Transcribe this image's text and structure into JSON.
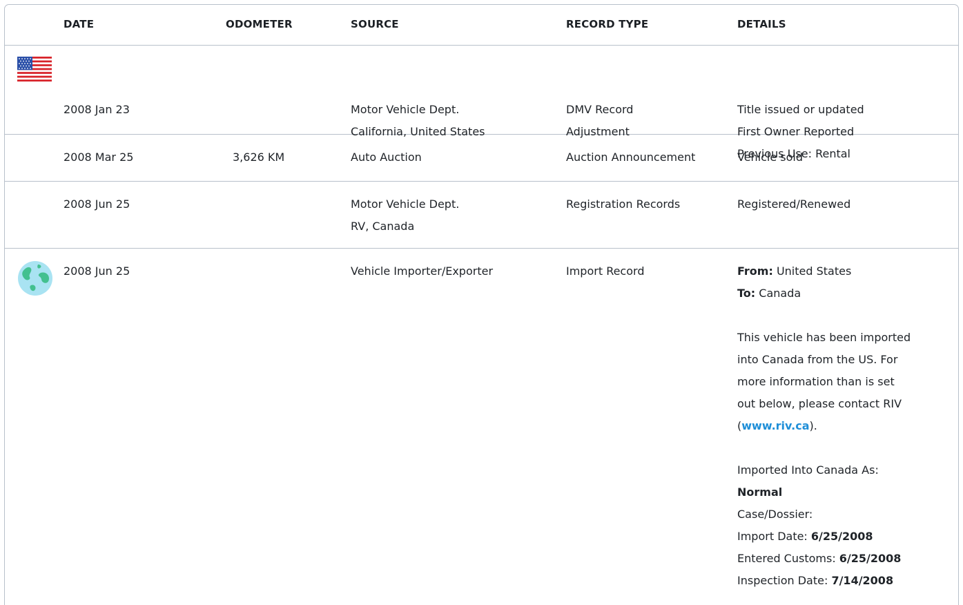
{
  "headers": {
    "date": "DATE",
    "odometer": "ODOMETER",
    "source": "SOURCE",
    "record_type": "RECORD TYPE",
    "details": "DETAILS"
  },
  "rows": [
    {
      "icon": "us-flag-icon",
      "date": "2008 Jan 23",
      "odometer": "",
      "source": [
        "Motor Vehicle Dept.",
        "California, United States"
      ],
      "record_type": [
        "DMV Record",
        "Adjustment"
      ],
      "details": [
        "Title issued or updated",
        "First Owner Reported",
        "Previous Use: Rental"
      ]
    },
    {
      "date": "2008 Mar 25",
      "odometer": "3,626 KM",
      "source": [
        "Auto Auction"
      ],
      "record_type": [
        "Auction Announcement"
      ],
      "details": [
        "Vehicle sold"
      ]
    },
    {
      "date": "2008 Jun 25",
      "odometer": "",
      "source": [
        "Motor Vehicle Dept.",
        "RV, Canada"
      ],
      "record_type": [
        "Registration Records"
      ],
      "details": [
        "Registered/Renewed"
      ]
    },
    {
      "icon": "globe-icon",
      "date": "2008 Jun 25",
      "odometer": "",
      "source": [
        "Vehicle Importer/Exporter"
      ],
      "record_type": [
        "Import Record"
      ],
      "details": {
        "from_label": "From:",
        "from_value": "United States",
        "to_label": "To:",
        "to_value": "Canada",
        "paragraph": [
          "This vehicle has been imported",
          "into Canada from the US. For",
          "more information than is set",
          "out below, please contact RIV"
        ],
        "link_open": "(",
        "link_text": "www.riv.ca",
        "link_close": ").",
        "imported_as_label": "Imported Into Canada As:",
        "imported_as_value": "Normal",
        "case_label": "Case/Dossier:",
        "import_date_label": "Import Date:",
        "import_date_value": "6/25/2008",
        "entered_customs_label": "Entered Customs:",
        "entered_customs_value": "6/25/2008",
        "inspection_date_label": "Inspection Date:",
        "inspection_date_value": "7/14/2008"
      }
    }
  ],
  "colors": {
    "border": "#b8c0ca",
    "link": "#1f8fd8"
  }
}
